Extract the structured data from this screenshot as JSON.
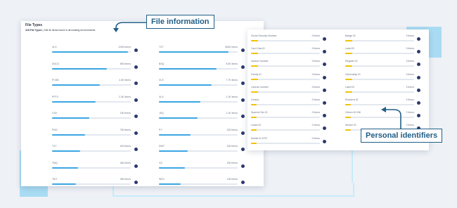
{
  "left_panel": {
    "title": "File Types",
    "subtitle_bold": "118 File Types",
    "subtitle_sep": "|",
    "subtitle_rest": "248.3k Items found in all working environments",
    "columns": [
      [
        {
          "label": "XLS",
          "count": "2000 Items",
          "fill": 0.96
        },
        {
          "label": "DOCX",
          "count": "890 Items",
          "fill": 0.7
        },
        {
          "label": "PCSB",
          "count": "4.3K Items",
          "fill": 0.61
        },
        {
          "label": "PPTX",
          "count": "2.3K Items",
          "fill": 0.55
        },
        {
          "label": "CSV",
          "count": "190 Items",
          "fill": 0.47
        },
        {
          "label": "PNG",
          "count": "750 Items",
          "fill": 0.42
        },
        {
          "label": "TXT",
          "count": "400 Items",
          "fill": 0.36
        },
        {
          "label": "TMQ",
          "count": "360 Items",
          "fill": 0.33
        },
        {
          "label": "TIKT",
          "count": "350 Items",
          "fill": 0.3
        }
      ],
      [
        {
          "label": "TXT",
          "count": "363K Items",
          "fill": 0.88
        },
        {
          "label": "BSQ",
          "count": "9.5K Items",
          "fill": 0.73
        },
        {
          "label": "XLS",
          "count": "7.7K Items",
          "fill": 0.67
        },
        {
          "label": "XLS",
          "count": "1.1K Items",
          "fill": 0.53
        },
        {
          "label": "JSQ",
          "count": "1.1K Items",
          "fill": 0.49
        },
        {
          "label": "PY",
          "count": "320 Items",
          "fill": 0.4
        },
        {
          "label": "DWT",
          "count": "300 Items",
          "fill": 0.37
        },
        {
          "label": "GZ",
          "count": "250 Items",
          "fill": 0.33
        },
        {
          "label": "WZX",
          "count": "130 Items",
          "fill": 0.28
        }
      ]
    ]
  },
  "right_panel": {
    "columns": [
      [
        {
          "label": "Social Security Number",
          "count": "3 Items",
          "fill": 0.1
        },
        {
          "label": "Card Visa ID",
          "count": "3 Items",
          "fill": 0.1
        },
        {
          "label": "Aadhar Number",
          "count": "3 Items",
          "fill": 0.1
        },
        {
          "label": "Family ID",
          "count": "3 Items",
          "fill": 0.1
        },
        {
          "label": "License number",
          "count": "3 Items",
          "fill": 0.1
        },
        {
          "label": "Cedula",
          "count": "2 Items",
          "fill": 0.08
        },
        {
          "label": "Spanish Tax ID",
          "count": "2 Items",
          "fill": 0.08
        },
        {
          "label": "Lease ID",
          "count": "2 Items",
          "fill": 0.08
        },
        {
          "label": "Mobile ID DTR",
          "count": "2 Items",
          "fill": 0.08
        }
      ],
      [
        {
          "label": "Badge ID",
          "count": "3 Items",
          "fill": 0.1
        },
        {
          "label": "Label ID",
          "count": "3 Items",
          "fill": 0.1
        },
        {
          "label": "Register ID",
          "count": "3 Items",
          "fill": 0.1
        },
        {
          "label": "Citizenship ID",
          "count": "3 Items",
          "fill": 0.1
        },
        {
          "label": "Label ID",
          "count": "3 Items",
          "fill": 0.1
        },
        {
          "label": "Resident ID",
          "count": "2 Items",
          "fill": 0.08
        },
        {
          "label": "Citizen ID DNI",
          "count": "2 Items",
          "fill": 0.08
        },
        {
          "label": "Worker ID",
          "count": "2 Items",
          "fill": 0.08
        }
      ]
    ]
  },
  "callouts": {
    "file_information": "File information",
    "personal_identifiers": "Personal identifiers"
  },
  "colors": {
    "blue_fill": "#3aa6e3",
    "yellow_fill": "#f2c200",
    "callout_border": "#1f5e86",
    "dot": "#2c3a6e"
  }
}
